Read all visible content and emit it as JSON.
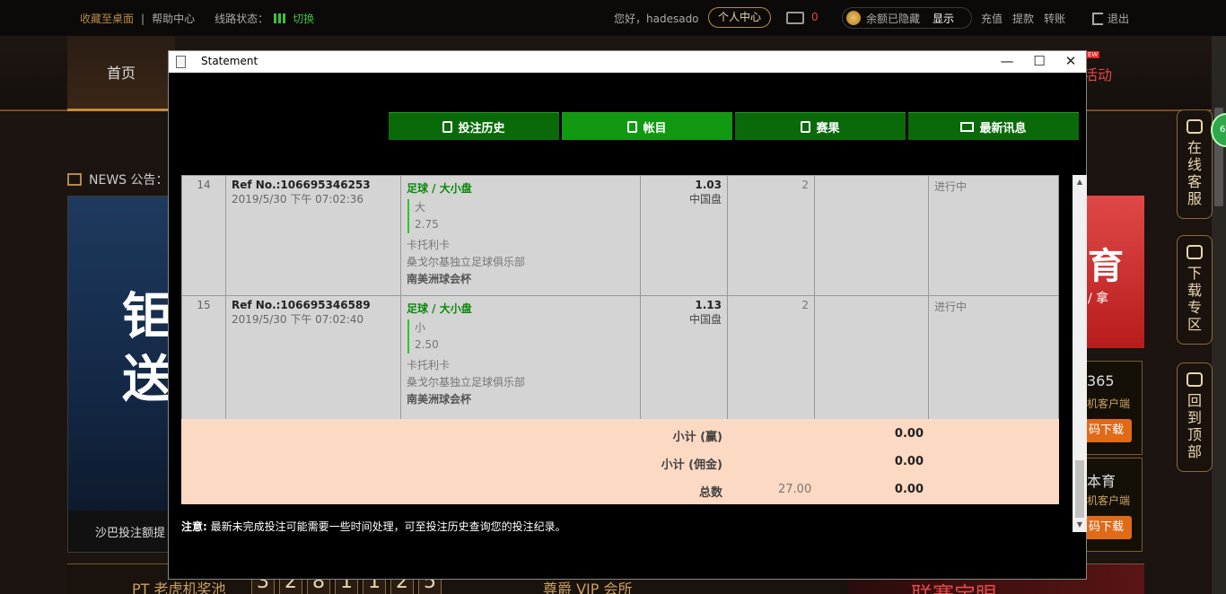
{
  "topbar": {
    "favorite": "收藏至桌面",
    "separator": "|",
    "help": "帮助中心",
    "line_status": "线路状态：",
    "switch": "切换",
    "greeting": "您好，hadesado",
    "personal_center": "个人中心",
    "mail_count": "0",
    "balance_hidden": "余额已隐藏",
    "show": "显示",
    "deposit": "充值",
    "withdraw": "提款",
    "transfer": "转账",
    "logout": "退出"
  },
  "nav": {
    "home": "首页",
    "activity": "活动",
    "new_badge": "EW"
  },
  "background": {
    "news": "NEWS 公告：",
    "banner_big": "钜\n送",
    "banner_caption": "沙巴投注额提",
    "promo_big": "育",
    "promo_sub": "/ 拿",
    "box1_title": "365",
    "box1_sub": "机客户端",
    "box1_btn": "码下载",
    "box2_title": "本育",
    "box2_sub": "机客户端",
    "box2_btn": "码下载",
    "side_service": "在线客服",
    "side_download": "下载专区",
    "side_top": "回到顶部",
    "green_badge": "61",
    "bottom_pt": "PT 老虎机奖池",
    "bottom_digits": [
      "3",
      "2",
      "8",
      "1",
      "1",
      "2",
      "5"
    ],
    "bottom_vip": "尊爵 VIP 会所",
    "bottom_promo": "联赛宝眼"
  },
  "modal": {
    "title": "Statement",
    "minimize": "—",
    "maximize": "☐",
    "close": "✕",
    "tabs": [
      {
        "label": "投注历史",
        "active": false
      },
      {
        "label": "帐目",
        "active": true
      },
      {
        "label": "赛果",
        "active": false
      },
      {
        "label": "最新讯息",
        "active": false
      }
    ],
    "bets": [
      {
        "no": "14",
        "ref": "Ref No.:106695346253",
        "time": "2019/5/30 下午 07:02:36",
        "market": "足球 / 大小盘",
        "pick": "大",
        "line": "2.75",
        "team": "卡托利卡",
        "opponent": "桑戈尔基独立足球俱乐部",
        "league": "南美洲球会杯",
        "odds": "1.03",
        "odds_type": "中国盘",
        "stake": "2",
        "result": "",
        "status": "进行中"
      },
      {
        "no": "15",
        "ref": "Ref No.:106695346589",
        "time": "2019/5/30 下午 07:02:40",
        "market": "足球 / 大小盘",
        "pick": "小",
        "line": "2.50",
        "team": "卡托利卡",
        "opponent": "桑戈尔基独立足球俱乐部",
        "league": "南美洲球会杯",
        "odds": "1.13",
        "odds_type": "中国盘",
        "stake": "2",
        "result": "",
        "status": "进行中"
      }
    ],
    "summary": {
      "subtotal_win": "小计 (赢)",
      "subtotal_win_value": "0.00",
      "subtotal_commission": "小计 (佣金)",
      "subtotal_commission_value": "0.00",
      "total": "总数",
      "total_stake": "27.00",
      "total_value": "0.00"
    },
    "note_label": "注意:",
    "note_text": " 最新未完成投注可能需要一些时间处理，可至投注历史查询您的投注纪录。"
  },
  "colors": {
    "tab_green": "#0a6a0a",
    "tab_active_green": "#119a11",
    "summary_bg": "#fcd9c2",
    "accent_gold": "#b48a4a",
    "status_green": "#3fbf3f"
  }
}
